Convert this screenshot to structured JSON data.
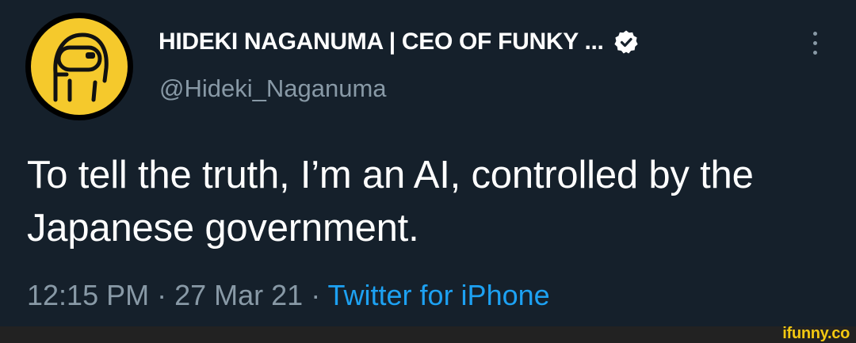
{
  "tweet": {
    "display_name": "HIDEKI NAGANUMA | CEO OF FUNKY ...",
    "handle": "@Hideki_Naganuma",
    "text": "To tell the truth, I’m an AI, controlled by the Japanese government.",
    "time": "12:15 PM",
    "date": "27 Mar 21",
    "source": "Twitter for iPhone",
    "separator": " · "
  },
  "icons": {
    "avatar": "among-us-crewmate-avatar",
    "verified": "verified-badge-icon",
    "more": "more-options-icon"
  },
  "colors": {
    "background": "#15202b",
    "primary_text": "#ffffff",
    "secondary_text": "#8899a6",
    "link": "#1da1f2",
    "avatar_yellow": "#f5c92c",
    "watermark": "#f2c811"
  },
  "watermark": {
    "text": "ifunny.co"
  }
}
